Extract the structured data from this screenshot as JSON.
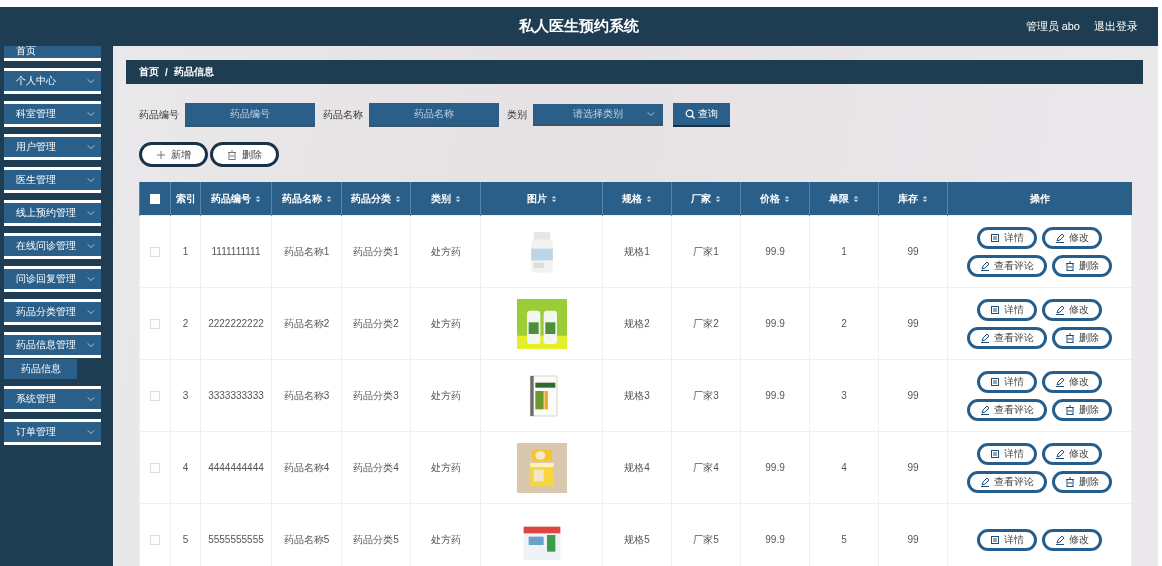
{
  "header": {
    "title": "私人医生预约系统",
    "user": "管理员 abo",
    "logout": "退出登录"
  },
  "sidebar": {
    "items": [
      {
        "label": "首页",
        "expandable": false
      },
      {
        "label": "个人中心",
        "expandable": true
      },
      {
        "label": "科室管理",
        "expandable": true
      },
      {
        "label": "用户管理",
        "expandable": true
      },
      {
        "label": "医生管理",
        "expandable": true
      },
      {
        "label": "线上预约管理",
        "expandable": true
      },
      {
        "label": "在线问诊管理",
        "expandable": true
      },
      {
        "label": "问诊回复管理",
        "expandable": true
      },
      {
        "label": "药品分类管理",
        "expandable": true
      },
      {
        "label": "药品信息管理",
        "expandable": true,
        "children": [
          {
            "label": "药品信息",
            "selected": true
          }
        ]
      },
      {
        "label": "系统管理",
        "expandable": true
      },
      {
        "label": "订单管理",
        "expandable": true
      }
    ]
  },
  "breadcrumb": [
    "首页",
    "/",
    "药品信息"
  ],
  "search": {
    "fields": [
      {
        "kind": "input",
        "label": "药品编号",
        "placeholder": "药品编号"
      },
      {
        "kind": "input",
        "label": "药品名称",
        "placeholder": "药品名称"
      },
      {
        "kind": "select",
        "label": "类别",
        "placeholder": "请选择类别"
      }
    ],
    "button": "查询"
  },
  "actions": [
    {
      "kind": "add",
      "label": "新增"
    },
    {
      "kind": "delete",
      "label": "删除"
    }
  ],
  "table": {
    "columns": [
      {
        "kind": "checkbox",
        "checked": false
      },
      {
        "label": "索引",
        "sortable": false
      },
      {
        "label": "药品编号",
        "sortable": true
      },
      {
        "label": "药品名称",
        "sortable": true
      },
      {
        "label": "药品分类",
        "sortable": true
      },
      {
        "label": "类别",
        "sortable": true
      },
      {
        "label": "图片",
        "sortable": true
      },
      {
        "label": "规格",
        "sortable": true
      },
      {
        "label": "厂家",
        "sortable": true
      },
      {
        "label": "价格",
        "sortable": true
      },
      {
        "label": "单限",
        "sortable": true
      },
      {
        "label": "库存",
        "sortable": true
      },
      {
        "label": "操作",
        "sortable": false
      }
    ],
    "rows": [
      {
        "cells": [
          {
            "kind": "checkbox",
            "checked": false
          },
          "1",
          "1111111111",
          "药品名称1",
          "药品分类1",
          "处方药",
          {
            "kind": "picture"
          },
          "规格1",
          "厂家1",
          "99.9",
          "1",
          "99",
          {
            "kind": "actions",
            "buttons": [
              {
                "kind": "detail",
                "label": "详情"
              },
              {
                "kind": "edit",
                "label": "修改"
              },
              {
                "kind": "comment",
                "label": "查看评论"
              },
              {
                "kind": "delete",
                "label": "删除"
              }
            ]
          }
        ]
      },
      {
        "cells": [
          {
            "kind": "checkbox",
            "checked": false
          },
          "2",
          "2222222222",
          "药品名称2",
          "药品分类2",
          "处方药",
          {
            "kind": "picture"
          },
          "规格2",
          "厂家2",
          "99.9",
          "2",
          "99",
          {
            "kind": "actions",
            "buttons": [
              {
                "kind": "detail",
                "label": "详情"
              },
              {
                "kind": "edit",
                "label": "修改"
              },
              {
                "kind": "comment",
                "label": "查看评论"
              },
              {
                "kind": "delete",
                "label": "删除"
              }
            ]
          }
        ]
      },
      {
        "cells": [
          {
            "kind": "checkbox",
            "checked": false
          },
          "3",
          "3333333333",
          "药品名称3",
          "药品分类3",
          "处方药",
          {
            "kind": "picture"
          },
          "规格3",
          "厂家3",
          "99.9",
          "3",
          "99",
          {
            "kind": "actions",
            "buttons": [
              {
                "kind": "detail",
                "label": "详情"
              },
              {
                "kind": "edit",
                "label": "修改"
              },
              {
                "kind": "comment",
                "label": "查看评论"
              },
              {
                "kind": "delete",
                "label": "删除"
              }
            ]
          }
        ]
      },
      {
        "cells": [
          {
            "kind": "checkbox",
            "checked": false
          },
          "4",
          "4444444444",
          "药品名称4",
          "药品分类4",
          "处方药",
          {
            "kind": "picture"
          },
          "规格4",
          "厂家4",
          "99.9",
          "4",
          "99",
          {
            "kind": "actions",
            "buttons": [
              {
                "kind": "detail",
                "label": "详情"
              },
              {
                "kind": "edit",
                "label": "修改"
              },
              {
                "kind": "comment",
                "label": "查看评论"
              },
              {
                "kind": "delete",
                "label": "删除"
              }
            ]
          }
        ]
      },
      {
        "cells": [
          {
            "kind": "checkbox",
            "checked": false
          },
          "5",
          "5555555555",
          "药品名称5",
          "药品分类5",
          "处方药",
          {
            "kind": "picture"
          },
          "规格5",
          "厂家5",
          "99.9",
          "5",
          "99",
          {
            "kind": "actions",
            "buttons": [
              {
                "kind": "detail",
                "label": "详情"
              },
              {
                "kind": "edit",
                "label": "修改"
              }
            ]
          }
        ]
      }
    ]
  }
}
